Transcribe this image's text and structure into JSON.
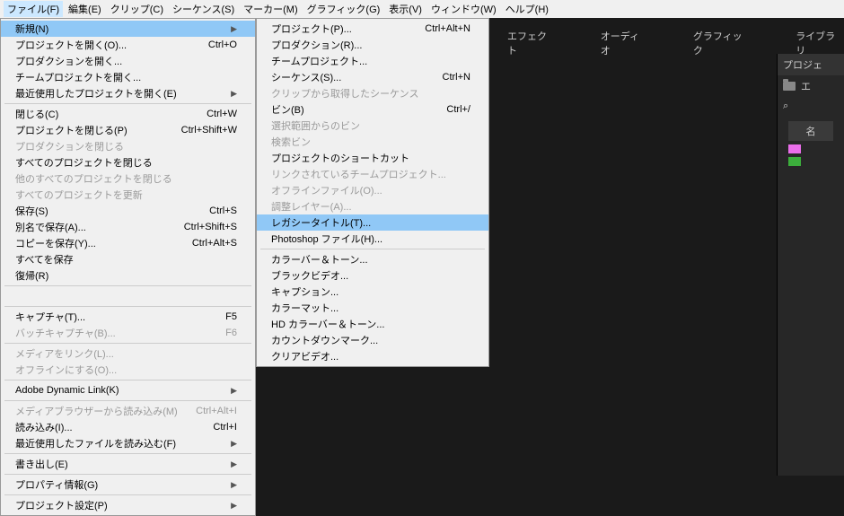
{
  "menubar": {
    "items": [
      {
        "label": "ファイル(F)"
      },
      {
        "label": "編集(E)"
      },
      {
        "label": "クリップ(C)"
      },
      {
        "label": "シーケンス(S)"
      },
      {
        "label": "マーカー(M)"
      },
      {
        "label": "グラフィック(G)"
      },
      {
        "label": "表示(V)"
      },
      {
        "label": "ウィンドウ(W)"
      },
      {
        "label": "ヘルプ(H)"
      }
    ]
  },
  "dropdown": {
    "groups": [
      [
        {
          "label": "新規(N)",
          "shortcut": "",
          "arrow": true,
          "highlighted": true
        },
        {
          "label": "プロジェクトを開く(O)...",
          "shortcut": "Ctrl+O"
        },
        {
          "label": "プロダクションを開く...",
          "shortcut": ""
        },
        {
          "label": "チームプロジェクトを開く...",
          "shortcut": ""
        },
        {
          "label": "最近使用したプロジェクトを開く(E)",
          "shortcut": "",
          "arrow": true
        }
      ],
      [
        {
          "label": "閉じる(C)",
          "shortcut": "Ctrl+W"
        },
        {
          "label": "プロジェクトを閉じる(P)",
          "shortcut": "Ctrl+Shift+W"
        },
        {
          "label": "プロダクションを閉じる",
          "shortcut": "",
          "disabled": true
        },
        {
          "label": "すべてのプロジェクトを閉じる",
          "shortcut": ""
        },
        {
          "label": "他のすべてのプロジェクトを閉じる",
          "shortcut": "",
          "disabled": true
        },
        {
          "label": "すべてのプロジェクトを更新",
          "shortcut": "",
          "disabled": true
        },
        {
          "label": "保存(S)",
          "shortcut": "Ctrl+S"
        },
        {
          "label": "別名で保存(A)...",
          "shortcut": "Ctrl+Shift+S"
        },
        {
          "label": "コピーを保存(Y)...",
          "shortcut": "Ctrl+Alt+S"
        },
        {
          "label": "すべてを保存",
          "shortcut": ""
        },
        {
          "label": "復帰(R)",
          "shortcut": ""
        }
      ],
      [
        {
          "label": "",
          "shortcut": "",
          "disabled": true
        }
      ],
      [
        {
          "label": "キャプチャ(T)...",
          "shortcut": "F5"
        },
        {
          "label": "バッチキャプチャ(B)...",
          "shortcut": "F6",
          "disabled": true
        }
      ],
      [
        {
          "label": "メディアをリンク(L)...",
          "shortcut": "",
          "disabled": true
        },
        {
          "label": "オフラインにする(O)...",
          "shortcut": "",
          "disabled": true
        }
      ],
      [
        {
          "label": "Adobe Dynamic Link(K)",
          "shortcut": "",
          "arrow": true
        }
      ],
      [
        {
          "label": "メディアブラウザーから読み込み(M)",
          "shortcut": "Ctrl+Alt+I",
          "disabled": true
        },
        {
          "label": "読み込み(I)...",
          "shortcut": "Ctrl+I"
        },
        {
          "label": "最近使用したファイルを読み込む(F)",
          "shortcut": "",
          "arrow": true
        }
      ],
      [
        {
          "label": "書き出し(E)",
          "shortcut": "",
          "arrow": true
        }
      ],
      [
        {
          "label": "プロパティ情報(G)",
          "shortcut": "",
          "arrow": true
        }
      ],
      [
        {
          "label": "プロジェクト設定(P)",
          "shortcut": "",
          "arrow": true
        }
      ]
    ]
  },
  "submenu": {
    "groups": [
      [
        {
          "label": "プロジェクト(P)...",
          "shortcut": "Ctrl+Alt+N"
        },
        {
          "label": "プロダクション(R)...",
          "shortcut": ""
        },
        {
          "label": "チームプロジェクト...",
          "shortcut": ""
        },
        {
          "label": "シーケンス(S)...",
          "shortcut": "Ctrl+N"
        },
        {
          "label": "クリップから取得したシーケンス",
          "shortcut": "",
          "disabled": true
        },
        {
          "label": "ビン(B)",
          "shortcut": "Ctrl+/"
        },
        {
          "label": "選択範囲からのビン",
          "shortcut": "",
          "disabled": true
        },
        {
          "label": "検索ビン",
          "shortcut": "",
          "disabled": true
        },
        {
          "label": "プロジェクトのショートカット",
          "shortcut": ""
        },
        {
          "label": "リンクされているチームプロジェクト...",
          "shortcut": "",
          "disabled": true
        },
        {
          "label": "オフラインファイル(O)...",
          "shortcut": "",
          "disabled": true
        },
        {
          "label": "調整レイヤー(A)...",
          "shortcut": "",
          "disabled": true
        },
        {
          "label": "レガシータイトル(T)...",
          "shortcut": "",
          "highlighted": true
        },
        {
          "label": "Photoshop ファイル(H)...",
          "shortcut": ""
        }
      ],
      [
        {
          "label": "カラーバー＆トーン...",
          "shortcut": ""
        },
        {
          "label": "ブラックビデオ...",
          "shortcut": ""
        },
        {
          "label": "キャプション...",
          "shortcut": ""
        },
        {
          "label": "カラーマット...",
          "shortcut": ""
        },
        {
          "label": "HD カラーバー＆トーン...",
          "shortcut": ""
        },
        {
          "label": "カウントダウンマーク...",
          "shortcut": ""
        },
        {
          "label": "クリアビデオ...",
          "shortcut": ""
        }
      ]
    ]
  },
  "tabs": {
    "items": [
      {
        "label": "エフェクト"
      },
      {
        "label": "オーディオ"
      },
      {
        "label": "グラフィック"
      },
      {
        "label": "ライブラリ"
      }
    ]
  },
  "panel": {
    "header": "プロジェ",
    "row_e": "エ",
    "name": "名"
  }
}
